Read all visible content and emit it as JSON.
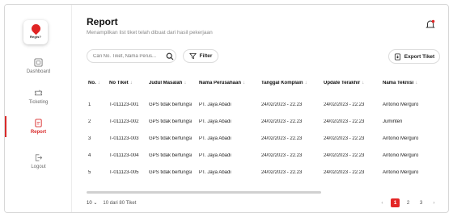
{
  "logo": {
    "text": "Regis?"
  },
  "sidebar": {
    "items": [
      {
        "label": "Dashboard",
        "icon": "dashboard-icon",
        "active": false
      },
      {
        "label": "Ticketing",
        "icon": "ticket-icon",
        "active": false
      },
      {
        "label": "Report",
        "icon": "report-icon",
        "active": true
      },
      {
        "label": "Logout",
        "icon": "logout-icon",
        "active": false
      }
    ]
  },
  "header": {
    "title": "Report",
    "subtitle": "Menampilkan list tiket telah dibuat dari hasil pekerjaan",
    "notification_icon": "bell-icon"
  },
  "toolbar": {
    "search_placeholder": "Cari No. Tiket, Nama Perus...",
    "filter_label": "Filter",
    "export_label": "Export Tiket"
  },
  "table": {
    "columns": [
      "No.",
      "No Tiket",
      "Judul Masalah",
      "Nama Perusahaan",
      "Tanggal Komplain",
      "Update Terakhir",
      "Nama Teknisi"
    ],
    "sort_glyph": "↓",
    "rows": [
      [
        "1",
        "T-011123-001",
        "GPS tidak berfungsi",
        "PT. Jaya Abadi",
        "24/02/2023 - 22.23",
        "24/02/2023 - 22.23",
        "Antonio Merguro"
      ],
      [
        "2",
        "T-011123-002",
        "GPS tidak berfungsi",
        "PT. Jaya Abadi",
        "24/02/2023 - 22.23",
        "24/02/2023 - 22.23",
        "Juminten"
      ],
      [
        "3",
        "T-011123-003",
        "GPS tidak berfungsi",
        "PT. Jaya Abadi",
        "24/02/2023 - 22.23",
        "24/02/2023 - 22.23",
        "Antonio Merguro"
      ],
      [
        "4",
        "T-011123-004",
        "GPS tidak berfungsi",
        "PT. Jaya Abadi",
        "24/02/2023 - 22.23",
        "24/02/2023 - 22.23",
        "Antonio Merguro"
      ],
      [
        "5",
        "T-011123-005",
        "GPS tidak berfungsi",
        "PT. Jaya Abadi",
        "24/02/2023 - 22.23",
        "24/02/2023 - 22.23",
        "Antonio Merguro"
      ]
    ]
  },
  "footer": {
    "per_page": "10",
    "per_page_caret": "⌄",
    "total": "10 dari 80 Tiket",
    "pages": [
      "1",
      "2",
      "3"
    ],
    "active_page": "1",
    "prev": "‹",
    "next": "›"
  },
  "colors": {
    "accent": "#e32626",
    "border": "#dcdcdc",
    "muted": "#8a8a8a"
  }
}
